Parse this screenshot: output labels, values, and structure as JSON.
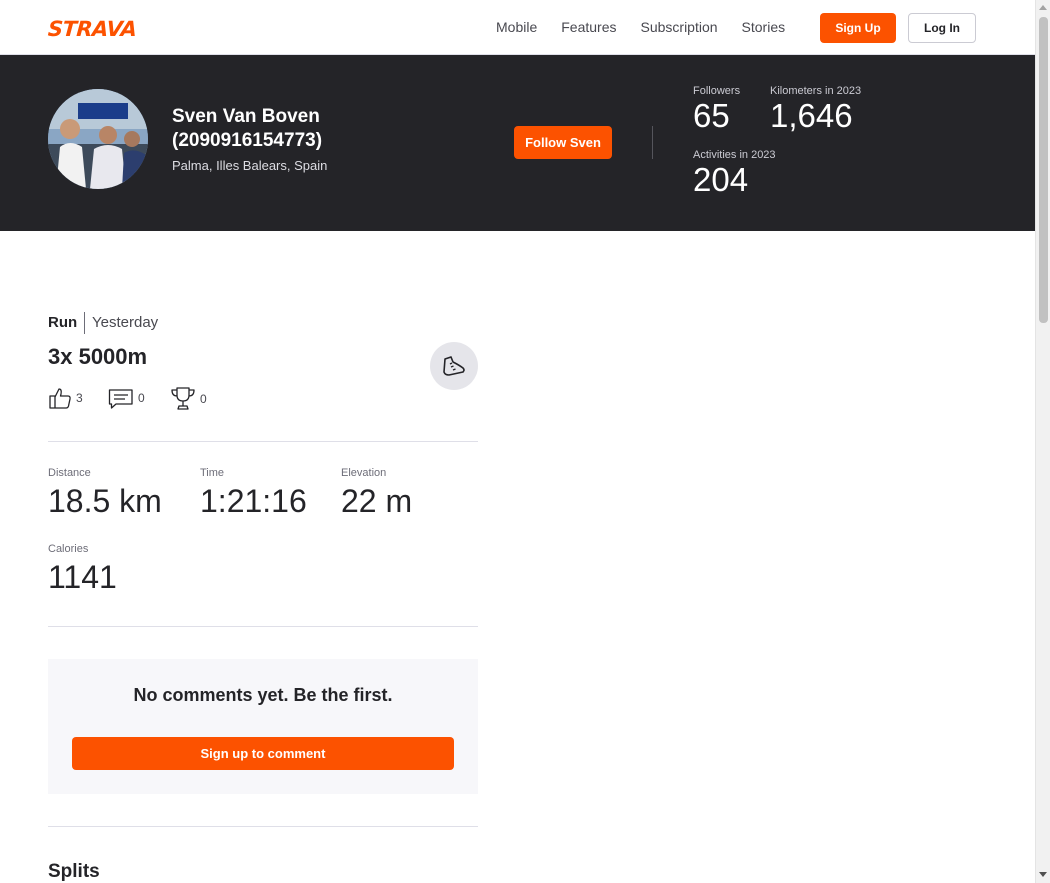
{
  "nav": {
    "logo": "STRAVA",
    "links": [
      "Mobile",
      "Features",
      "Subscription",
      "Stories"
    ],
    "signup": "Sign Up",
    "login": "Log In"
  },
  "athlete": {
    "name": "Sven Van Boven (2090916154773)",
    "location": "Palma, Illes Balears, Spain",
    "follow": "Follow Sven",
    "stats": {
      "followers_label": "Followers",
      "followers_value": "65",
      "km_label": "Kilometers in 2023",
      "km_value": "1,646",
      "activities_label": "Activities in 2023",
      "activities_value": "204"
    }
  },
  "activity": {
    "type": "Run",
    "when": "Yesterday",
    "title": "3x 5000m",
    "icon": "running-shoe-icon",
    "kudos": "3",
    "comments": "0",
    "achievements": "0",
    "metrics": {
      "distance_label": "Distance",
      "distance_value": "18.5 km",
      "time_label": "Time",
      "time_value": "1:21:16",
      "elevation_label": "Elevation",
      "elevation_value": "22 m",
      "calories_label": "Calories",
      "calories_value": "1141"
    }
  },
  "comments": {
    "empty": "No comments yet. Be the first.",
    "button": "Sign up to comment"
  },
  "splits": {
    "title": "Splits"
  },
  "colors": {
    "brand": "#fc5200",
    "header_bg": "#242428"
  }
}
